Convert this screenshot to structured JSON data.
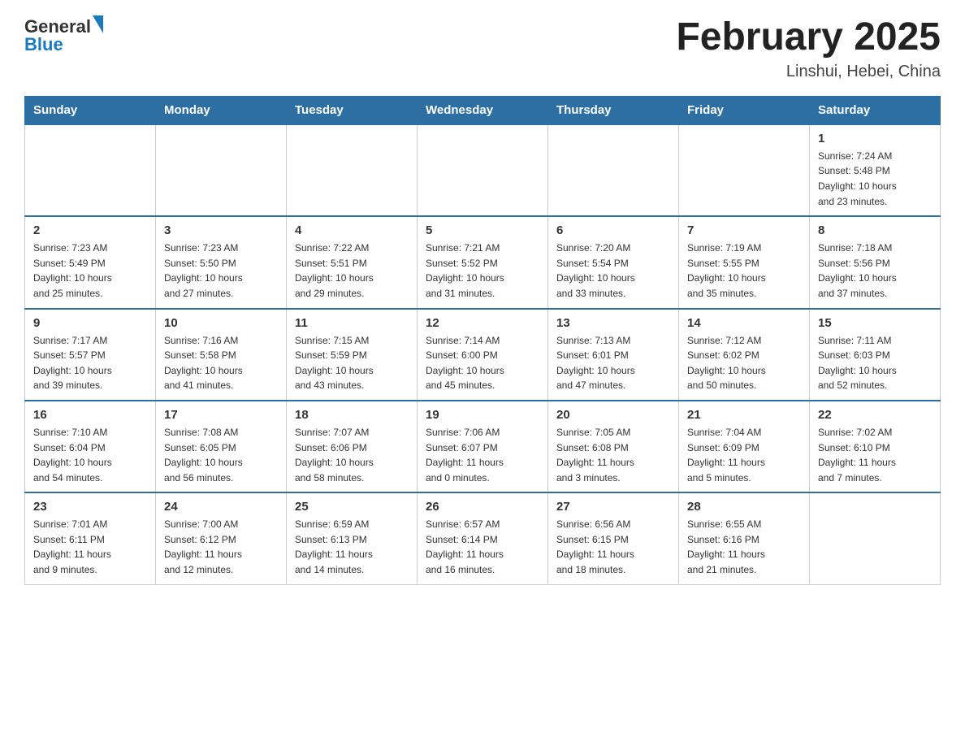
{
  "header": {
    "logo_text_main": "General",
    "logo_text_blue": "Blue",
    "month_title": "February 2025",
    "location": "Linshui, Hebei, China"
  },
  "weekdays": [
    "Sunday",
    "Monday",
    "Tuesday",
    "Wednesday",
    "Thursday",
    "Friday",
    "Saturday"
  ],
  "weeks": [
    [
      {
        "day": "",
        "info": ""
      },
      {
        "day": "",
        "info": ""
      },
      {
        "day": "",
        "info": ""
      },
      {
        "day": "",
        "info": ""
      },
      {
        "day": "",
        "info": ""
      },
      {
        "day": "",
        "info": ""
      },
      {
        "day": "1",
        "info": "Sunrise: 7:24 AM\nSunset: 5:48 PM\nDaylight: 10 hours\nand 23 minutes."
      }
    ],
    [
      {
        "day": "2",
        "info": "Sunrise: 7:23 AM\nSunset: 5:49 PM\nDaylight: 10 hours\nand 25 minutes."
      },
      {
        "day": "3",
        "info": "Sunrise: 7:23 AM\nSunset: 5:50 PM\nDaylight: 10 hours\nand 27 minutes."
      },
      {
        "day": "4",
        "info": "Sunrise: 7:22 AM\nSunset: 5:51 PM\nDaylight: 10 hours\nand 29 minutes."
      },
      {
        "day": "5",
        "info": "Sunrise: 7:21 AM\nSunset: 5:52 PM\nDaylight: 10 hours\nand 31 minutes."
      },
      {
        "day": "6",
        "info": "Sunrise: 7:20 AM\nSunset: 5:54 PM\nDaylight: 10 hours\nand 33 minutes."
      },
      {
        "day": "7",
        "info": "Sunrise: 7:19 AM\nSunset: 5:55 PM\nDaylight: 10 hours\nand 35 minutes."
      },
      {
        "day": "8",
        "info": "Sunrise: 7:18 AM\nSunset: 5:56 PM\nDaylight: 10 hours\nand 37 minutes."
      }
    ],
    [
      {
        "day": "9",
        "info": "Sunrise: 7:17 AM\nSunset: 5:57 PM\nDaylight: 10 hours\nand 39 minutes."
      },
      {
        "day": "10",
        "info": "Sunrise: 7:16 AM\nSunset: 5:58 PM\nDaylight: 10 hours\nand 41 minutes."
      },
      {
        "day": "11",
        "info": "Sunrise: 7:15 AM\nSunset: 5:59 PM\nDaylight: 10 hours\nand 43 minutes."
      },
      {
        "day": "12",
        "info": "Sunrise: 7:14 AM\nSunset: 6:00 PM\nDaylight: 10 hours\nand 45 minutes."
      },
      {
        "day": "13",
        "info": "Sunrise: 7:13 AM\nSunset: 6:01 PM\nDaylight: 10 hours\nand 47 minutes."
      },
      {
        "day": "14",
        "info": "Sunrise: 7:12 AM\nSunset: 6:02 PM\nDaylight: 10 hours\nand 50 minutes."
      },
      {
        "day": "15",
        "info": "Sunrise: 7:11 AM\nSunset: 6:03 PM\nDaylight: 10 hours\nand 52 minutes."
      }
    ],
    [
      {
        "day": "16",
        "info": "Sunrise: 7:10 AM\nSunset: 6:04 PM\nDaylight: 10 hours\nand 54 minutes."
      },
      {
        "day": "17",
        "info": "Sunrise: 7:08 AM\nSunset: 6:05 PM\nDaylight: 10 hours\nand 56 minutes."
      },
      {
        "day": "18",
        "info": "Sunrise: 7:07 AM\nSunset: 6:06 PM\nDaylight: 10 hours\nand 58 minutes."
      },
      {
        "day": "19",
        "info": "Sunrise: 7:06 AM\nSunset: 6:07 PM\nDaylight: 11 hours\nand 0 minutes."
      },
      {
        "day": "20",
        "info": "Sunrise: 7:05 AM\nSunset: 6:08 PM\nDaylight: 11 hours\nand 3 minutes."
      },
      {
        "day": "21",
        "info": "Sunrise: 7:04 AM\nSunset: 6:09 PM\nDaylight: 11 hours\nand 5 minutes."
      },
      {
        "day": "22",
        "info": "Sunrise: 7:02 AM\nSunset: 6:10 PM\nDaylight: 11 hours\nand 7 minutes."
      }
    ],
    [
      {
        "day": "23",
        "info": "Sunrise: 7:01 AM\nSunset: 6:11 PM\nDaylight: 11 hours\nand 9 minutes."
      },
      {
        "day": "24",
        "info": "Sunrise: 7:00 AM\nSunset: 6:12 PM\nDaylight: 11 hours\nand 12 minutes."
      },
      {
        "day": "25",
        "info": "Sunrise: 6:59 AM\nSunset: 6:13 PM\nDaylight: 11 hours\nand 14 minutes."
      },
      {
        "day": "26",
        "info": "Sunrise: 6:57 AM\nSunset: 6:14 PM\nDaylight: 11 hours\nand 16 minutes."
      },
      {
        "day": "27",
        "info": "Sunrise: 6:56 AM\nSunset: 6:15 PM\nDaylight: 11 hours\nand 18 minutes."
      },
      {
        "day": "28",
        "info": "Sunrise: 6:55 AM\nSunset: 6:16 PM\nDaylight: 11 hours\nand 21 minutes."
      },
      {
        "day": "",
        "info": ""
      }
    ]
  ]
}
